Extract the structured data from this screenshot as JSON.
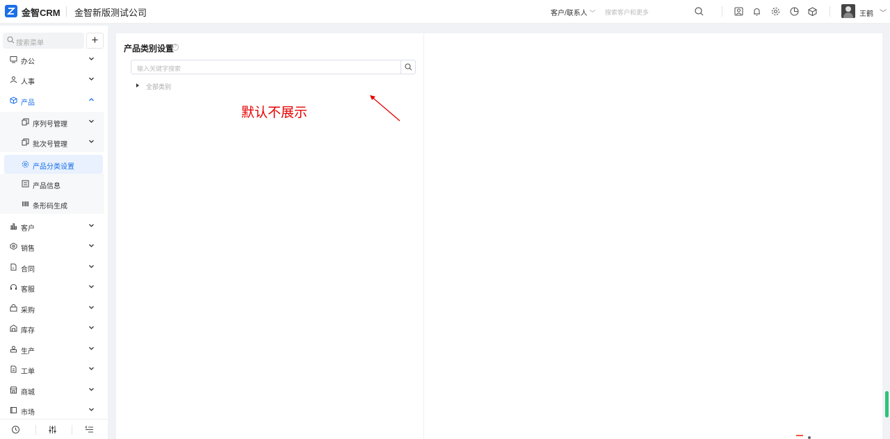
{
  "header": {
    "brand": "金智CRM",
    "company": "金智新版测试公司",
    "search_type": "客户/联系人",
    "search_placeholder": "搜索客户和更多",
    "icons": [
      "search-icon",
      "contacts-icon",
      "bell-icon",
      "gear-icon",
      "chart-icon",
      "cube-icon"
    ],
    "user_name": "王鹤"
  },
  "sidebar": {
    "search_placeholder": "搜索菜单",
    "add_label": "+",
    "items": [
      {
        "label": "办公",
        "icon": "monitor-icon",
        "expanded": false
      },
      {
        "label": "人事",
        "icon": "people-icon",
        "expanded": false
      },
      {
        "label": "产品",
        "icon": "box-icon",
        "expanded": true
      },
      {
        "label": "客户",
        "icon": "bar-chart-icon",
        "expanded": false
      },
      {
        "label": "销售",
        "icon": "hexagon-icon",
        "expanded": false
      },
      {
        "label": "合同",
        "icon": "contract-icon",
        "expanded": false
      },
      {
        "label": "客服",
        "icon": "headset-icon",
        "expanded": false
      },
      {
        "label": "采购",
        "icon": "basket-icon",
        "expanded": false
      },
      {
        "label": "库存",
        "icon": "warehouse-icon",
        "expanded": false
      },
      {
        "label": "生产",
        "icon": "factory-icon",
        "expanded": false
      },
      {
        "label": "工单",
        "icon": "ticket-icon",
        "expanded": false
      },
      {
        "label": "商城",
        "icon": "store-icon",
        "expanded": false
      },
      {
        "label": "市场",
        "icon": "flag-icon",
        "expanded": false
      }
    ],
    "product_children": [
      {
        "label": "序列号管理",
        "icon": "copy-icon",
        "has_children": true
      },
      {
        "label": "批次号管理",
        "icon": "copy-icon",
        "has_children": true
      },
      {
        "label": "产品分类设置",
        "icon": "settings-icon",
        "selected": true
      },
      {
        "label": "产品信息",
        "icon": "list-icon"
      },
      {
        "label": "条形码生成",
        "icon": "barcode-icon"
      }
    ],
    "bottom_icons": [
      "history-icon",
      "adjust-icon",
      "collapse-menu-icon"
    ]
  },
  "main": {
    "title": "产品类别设置",
    "help_glyph": "?",
    "search_placeholder": "输入关键字搜索",
    "tree_root": "全部类别",
    "annotation": "默认不展示"
  },
  "colors": {
    "accent": "#1a6fe8",
    "annotation": "#e60000",
    "selected_bg": "#e8f1fd"
  }
}
